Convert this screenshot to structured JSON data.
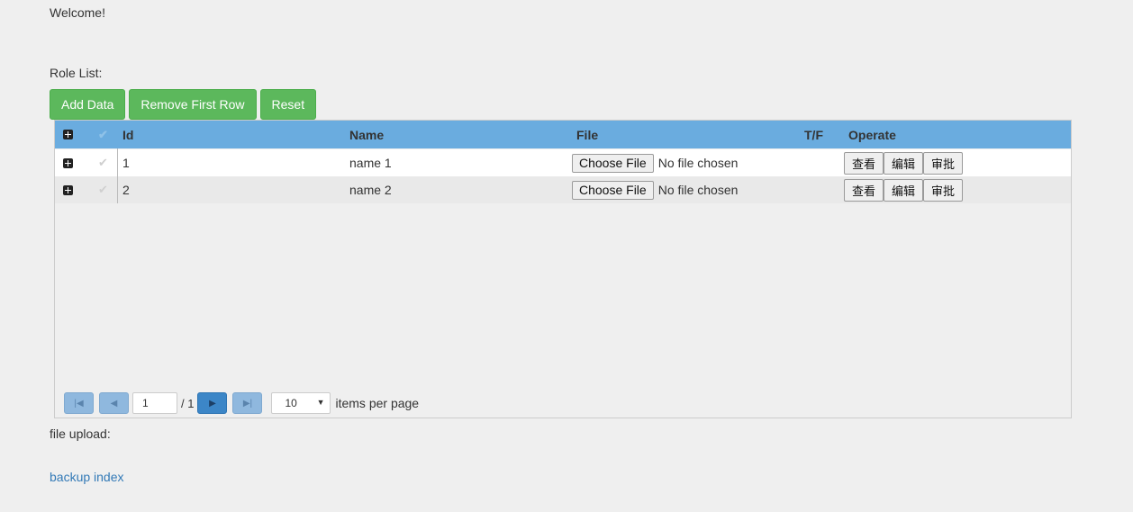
{
  "welcome": "Welcome!",
  "role_list_label": "Role List:",
  "toolbar": {
    "add_data": "Add Data",
    "remove_first_row": "Remove First Row",
    "reset": "Reset"
  },
  "grid": {
    "headers": {
      "id": "Id",
      "name": "Name",
      "file": "File",
      "tf": "T/F",
      "operate": "Operate"
    },
    "rows": [
      {
        "id": "1",
        "name": "name 1",
        "file_button": "Choose File",
        "file_status": "No file chosen",
        "tf": "",
        "ops": [
          "查看",
          "编辑",
          "审批"
        ]
      },
      {
        "id": "2",
        "name": "name 2",
        "file_button": "Choose File",
        "file_status": "No file chosen",
        "tf": "",
        "ops": [
          "查看",
          "编辑",
          "审批"
        ]
      }
    ],
    "pager": {
      "current_page": "1",
      "separator": "/",
      "total_pages": "1",
      "page_size": "10",
      "items_per_page": "items per page"
    }
  },
  "colors": {
    "header_bg": "#6aacdf",
    "button_green": "#5cb85c",
    "link": "#337ab7"
  },
  "file_upload_label": "file upload:",
  "backup_link": "backup index"
}
